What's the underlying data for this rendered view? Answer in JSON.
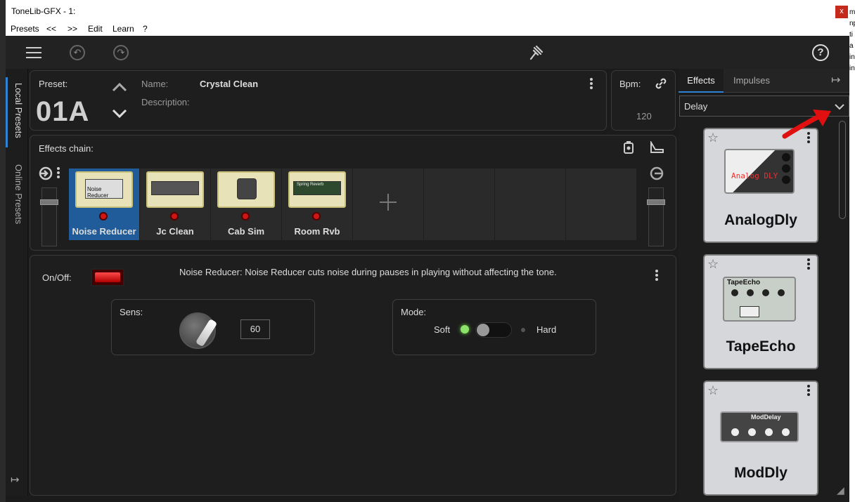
{
  "window": {
    "title": "ToneLib-GFX - 1:",
    "close": "x"
  },
  "menu": [
    "Presets",
    "<<",
    ">>",
    "Edit",
    "Learn",
    "?"
  ],
  "right_strip_chars": [
    "m",
    "np",
    "ti",
    "a",
    "in",
    "in",
    "e"
  ],
  "toolbar": {
    "help": "?"
  },
  "left_tabs": {
    "local": "Local Presets",
    "online": "Online Presets"
  },
  "preset": {
    "label": "Preset:",
    "number": "01A",
    "name_label": "Name:",
    "name": "Crystal Clean",
    "description_label": "Description:"
  },
  "bpm": {
    "label": "Bpm:",
    "value": "120"
  },
  "chain": {
    "label": "Effects chain:",
    "slots": [
      {
        "label": "Noise Reducer",
        "pedal": "Noise Reducer"
      },
      {
        "label": "Jc Clean"
      },
      {
        "label": "Cab Sim"
      },
      {
        "label": "Room Rvb",
        "pedal": "Spring Reverb"
      }
    ]
  },
  "detail": {
    "onoff_label": "On/Off:",
    "description": "Noise Reducer:  Noise Reducer cuts noise during pauses in playing without affecting the tone.",
    "sens_label": "Sens:",
    "sens_value": "60",
    "mode_label": "Mode:",
    "mode_soft": "Soft",
    "mode_hard": "Hard"
  },
  "library": {
    "tabs": [
      "Effects",
      "Impulses"
    ],
    "category": "Delay",
    "cards": [
      {
        "name": "AnalogDly",
        "pedal_text": "Analog DLY"
      },
      {
        "name": "TapeEcho",
        "pedal_text": "TapeEcho"
      },
      {
        "name": "ModDly",
        "pedal_text": "ModDelay"
      }
    ]
  },
  "colors": {
    "accent": "#2f83d6",
    "active_slot": "#1f5c99",
    "led_red": "#d01515",
    "arrow": "#e01010"
  }
}
